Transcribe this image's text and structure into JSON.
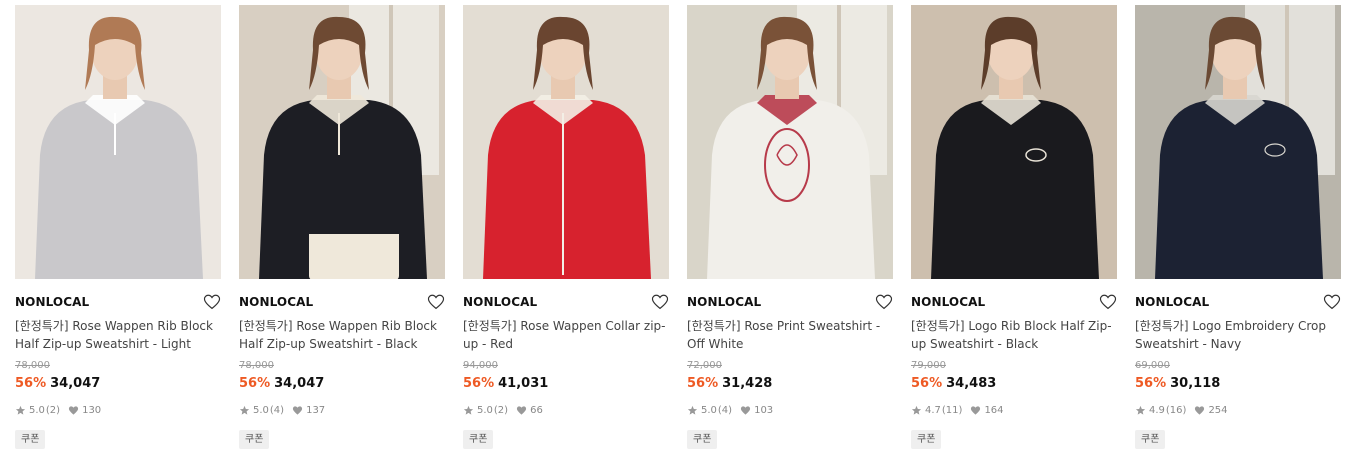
{
  "products": [
    {
      "brand": "NONLOCAL",
      "name": "[한정특가] Rose Wappen Rib Block Half Zip-up Sweatshirt - Light Grey",
      "original_price": "78,000",
      "discount": "56%",
      "price": "34,047",
      "rating": "5.0",
      "review_count": "(2)",
      "likes": "130",
      "badge": "쿠폰",
      "image": "woman in light grey half zip-up sweatshirt",
      "colors": {
        "bg": "#ece7e1",
        "garment": "#c9c8cb",
        "accent": "#ffffff",
        "hair": "#b07a55"
      }
    },
    {
      "brand": "NONLOCAL",
      "name": "[한정특가] Rose Wappen Rib Block Half Zip-up Sweatshirt - Black",
      "original_price": "78,000",
      "discount": "56%",
      "price": "34,047",
      "rating": "5.0",
      "review_count": "(4)",
      "likes": "137",
      "badge": "쿠폰",
      "image": "woman in black half zip-up sweatshirt holding tote bag",
      "colors": {
        "bg": "#d8cfc2",
        "garment": "#1d1e24",
        "accent": "#efe8da",
        "hair": "#6e4a33"
      }
    },
    {
      "brand": "NONLOCAL",
      "name": "[한정특가] Rose Wappen Collar zip-up - Red",
      "original_price": "94,000",
      "discount": "56%",
      "price": "41,031",
      "rating": "5.0",
      "review_count": "(2)",
      "likes": "66",
      "badge": "쿠폰",
      "image": "woman in red collar zip-up jacket",
      "colors": {
        "bg": "#e3ddd3",
        "garment": "#d7222e",
        "accent": "#f3efe6",
        "hair": "#6a4530"
      }
    },
    {
      "brand": "NONLOCAL",
      "name": "[한정특가] Rose Print Sweatshirt - Off White",
      "original_price": "72,000",
      "discount": "56%",
      "price": "31,428",
      "rating": "5.0",
      "review_count": "(4)",
      "likes": "103",
      "badge": "쿠폰",
      "image": "woman in off white rose print sweatshirt",
      "colors": {
        "bg": "#d9d5c9",
        "garment": "#f1efea",
        "accent": "#b73a4a",
        "hair": "#7a5238"
      }
    },
    {
      "brand": "NONLOCAL",
      "name": "[한정특가] Logo Rib Block Half Zip-up Sweatshirt - Black",
      "original_price": "79,000",
      "discount": "56%",
      "price": "34,483",
      "rating": "4.7",
      "review_count": "(11)",
      "likes": "164",
      "badge": "쿠폰",
      "image": "woman in black logo half zip-up sweatshirt sitting",
      "colors": {
        "bg": "#cdbfae",
        "garment": "#1a1a1e",
        "accent": "#e8e2d6",
        "hair": "#5c3d2a"
      }
    },
    {
      "brand": "NONLOCAL",
      "name": "[한정특가] Logo Embroidery Crop Sweatshirt - Navy",
      "original_price": "69,000",
      "discount": "56%",
      "price": "30,118",
      "rating": "4.9",
      "review_count": "(16)",
      "likes": "254",
      "badge": "쿠폰",
      "image": "woman in navy logo embroidery crop sweatshirt",
      "colors": {
        "bg": "#b9b5ab",
        "garment": "#1c2233",
        "accent": "#d8d6cf",
        "hair": "#6b4a34"
      }
    }
  ],
  "icons": {
    "wishlist": "heart-outline-icon",
    "rating": "star-icon",
    "likes": "heart-filled-icon"
  },
  "accent_color": "#ee5a24"
}
